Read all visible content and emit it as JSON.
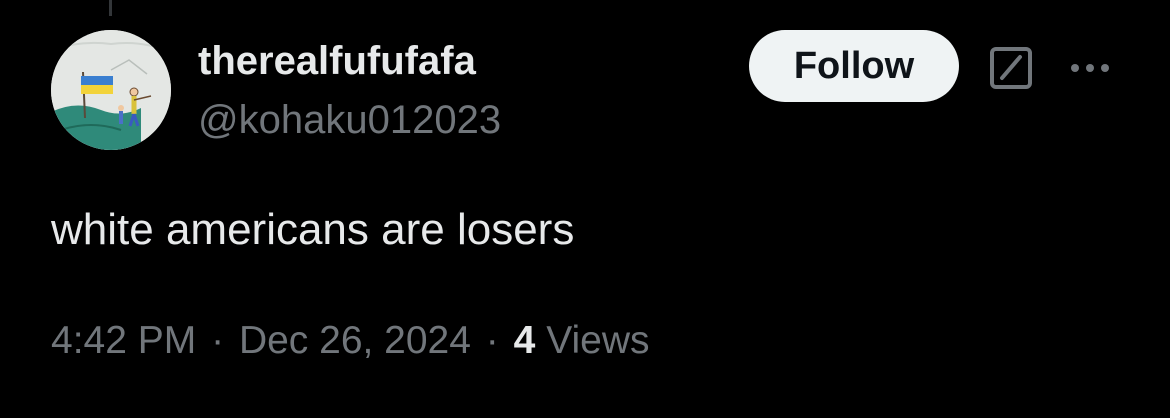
{
  "author": {
    "display_name": "therealfufufafa",
    "handle": "@kohaku012023",
    "avatar_icon": "child-drawing-avatar"
  },
  "actions": {
    "follow_label": "Follow",
    "grok_icon": "grok-icon",
    "more_icon": "more-options-icon"
  },
  "tweet": {
    "text": "white americans are losers"
  },
  "meta": {
    "time": "4:42 PM",
    "separator": "·",
    "date": "Dec 26, 2024",
    "views_count": "4",
    "views_label": "Views"
  },
  "colors": {
    "background": "#000000",
    "primary_text": "#e7e9ea",
    "secondary_text": "#71767b",
    "follow_button_bg": "#eff3f4",
    "follow_button_text": "#0f1419"
  }
}
